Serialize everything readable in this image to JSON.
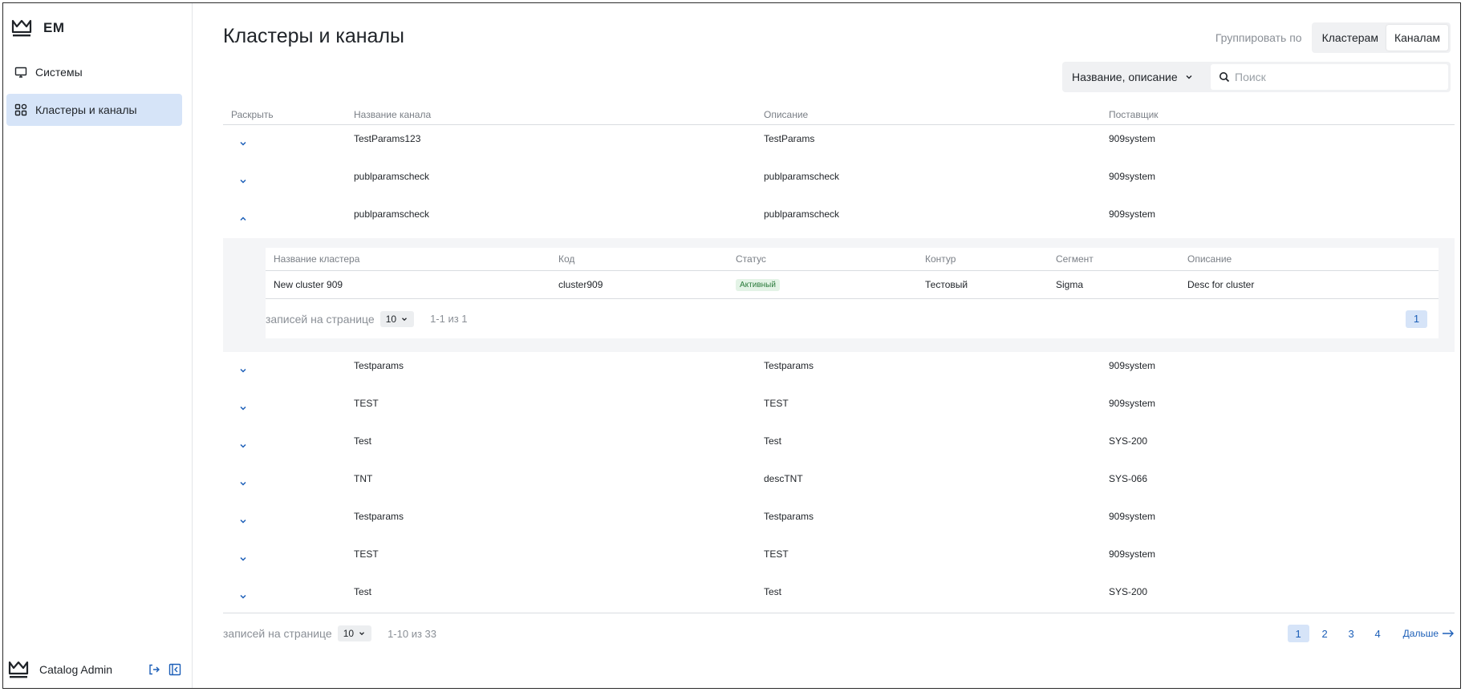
{
  "app": {
    "logo_text": "EM"
  },
  "sidebar": {
    "items": [
      {
        "label": "Системы",
        "icon": "monitor-icon",
        "active": false
      },
      {
        "label": "Кластеры и каналы",
        "icon": "grid-icon",
        "active": true
      }
    ],
    "footer": {
      "user": "Catalog Admin"
    }
  },
  "page": {
    "title": "Кластеры и каналы"
  },
  "group_by": {
    "label": "Группировать по",
    "options": [
      "Кластерам",
      "Каналам"
    ],
    "selected": "Каналам"
  },
  "filter": {
    "field": "Название, описание",
    "placeholder": "Поиск",
    "value": ""
  },
  "table": {
    "headers": [
      "Раскрыть",
      "Название канала",
      "Описание",
      "Поставщик"
    ],
    "rows_before": [
      {
        "name": "TestParams123",
        "description": "TestParams",
        "provider": "909system"
      },
      {
        "name": "publparamscheck",
        "description": "publparamscheck",
        "provider": "909system"
      },
      {
        "name": "publparamscheck",
        "description": "publparamscheck",
        "provider": "909system"
      }
    ],
    "rows_after": [
      {
        "name": "Testparams",
        "description": "Testparams",
        "provider": "909system"
      },
      {
        "name": "TEST",
        "description": "TEST",
        "provider": "909system"
      },
      {
        "name": "Test",
        "description": "Test",
        "provider": "SYS-200"
      },
      {
        "name": "TNT",
        "description": "descTNT",
        "provider": "SYS-066"
      },
      {
        "name": "Testparams",
        "description": "Testparams",
        "provider": "909system"
      },
      {
        "name": "TEST",
        "description": "TEST",
        "provider": "909system"
      },
      {
        "name": "Test",
        "description": "Test",
        "provider": "SYS-200"
      }
    ]
  },
  "subtable": {
    "headers": [
      "Название кластера",
      "Код",
      "Статус",
      "Контур",
      "Сегмент",
      "Описание"
    ],
    "rows": [
      {
        "name": "New cluster 909",
        "code": "cluster909",
        "status": "Активный",
        "contour": "Тестовый",
        "segment": "Sigma",
        "description": "Desc for cluster"
      }
    ],
    "pager": {
      "label": "записей на странице",
      "per_page": "10",
      "count": "1-1 из 1",
      "pages": [
        "1"
      ]
    }
  },
  "pager": {
    "label": "записей на странице",
    "per_page": "10",
    "count": "1-10 из 33",
    "pages": [
      "1",
      "2",
      "3",
      "4"
    ],
    "next": "Дальше"
  },
  "colors": {
    "accent": "#1c5fb8",
    "active_bg": "#d6e4f8",
    "status_bg": "#e3f3e6"
  }
}
